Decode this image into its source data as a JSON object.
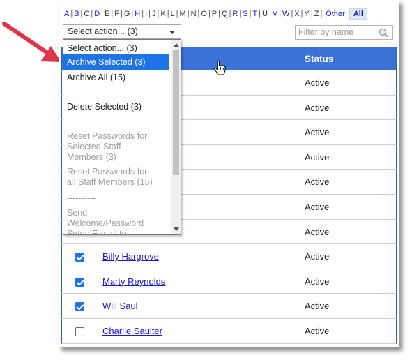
{
  "alphabet": {
    "letters": [
      {
        "t": "A",
        "link": true
      },
      {
        "t": "B",
        "link": true
      },
      {
        "t": "C",
        "link": false
      },
      {
        "t": "D",
        "link": true
      },
      {
        "t": "E",
        "link": false
      },
      {
        "t": "F",
        "link": false
      },
      {
        "t": "G",
        "link": false
      },
      {
        "t": "H",
        "link": true
      },
      {
        "t": "I",
        "link": false
      },
      {
        "t": "J",
        "link": false
      },
      {
        "t": "K",
        "link": false
      },
      {
        "t": "L",
        "link": false
      },
      {
        "t": "M",
        "link": false
      },
      {
        "t": "N",
        "link": false
      },
      {
        "t": "O",
        "link": false
      },
      {
        "t": "P",
        "link": false
      },
      {
        "t": "Q",
        "link": false
      },
      {
        "t": "R",
        "link": true
      },
      {
        "t": "S",
        "link": true
      },
      {
        "t": "T",
        "link": true
      },
      {
        "t": "U",
        "link": false
      },
      {
        "t": "V",
        "link": true
      },
      {
        "t": "W",
        "link": true
      },
      {
        "t": "X",
        "link": false
      },
      {
        "t": "Y",
        "link": false
      },
      {
        "t": "Z",
        "link": false
      }
    ],
    "other": "Other",
    "all": "All"
  },
  "action_select": {
    "value": "Select action... (3)",
    "options": [
      {
        "label": "Select action... (3)",
        "style": "normal"
      },
      {
        "label": "Archive Selected (3)",
        "style": "hl"
      },
      {
        "label": "Archive All (15)",
        "style": "normal"
      },
      {
        "label": "----------",
        "style": "dim"
      },
      {
        "label": "Delete Selected (3)",
        "style": "normal"
      },
      {
        "label": "----------",
        "style": "dim"
      },
      {
        "label": "Reset Passwords for\nSelected Staff\nMembers (3)",
        "style": "dim"
      },
      {
        "label": "Reset Passwords for\nall Staff Members (15)",
        "style": "dim"
      },
      {
        "label": "----------",
        "style": "dim"
      },
      {
        "label": "Send\nWelcome/Password\nSetup E-mail to",
        "style": "dim"
      }
    ]
  },
  "filter": {
    "placeholder": "Filter by name"
  },
  "table": {
    "status_header": "Status",
    "rows": [
      {
        "name": "",
        "status": "Active",
        "checked": null
      },
      {
        "name": "",
        "status": "Active",
        "checked": null
      },
      {
        "name": "",
        "status": "Active",
        "checked": null
      },
      {
        "name": "",
        "status": "Active",
        "checked": null
      },
      {
        "name": "",
        "status": "Active",
        "checked": null
      },
      {
        "name": "",
        "status": "Active",
        "checked": null
      },
      {
        "name": "",
        "status": "Active",
        "checked": null
      },
      {
        "name": "Billy Hargrove",
        "status": "Active",
        "checked": true
      },
      {
        "name": "Marty Reynolds",
        "status": "Active",
        "checked": true
      },
      {
        "name": "Will Saul",
        "status": "Active",
        "checked": true
      },
      {
        "name": "Charlie Saulter",
        "status": "Active",
        "checked": false
      }
    ]
  },
  "colors": {
    "header_blue": "#3a72d8",
    "highlight": "#1e73e8",
    "arrow": "#e0344b"
  }
}
